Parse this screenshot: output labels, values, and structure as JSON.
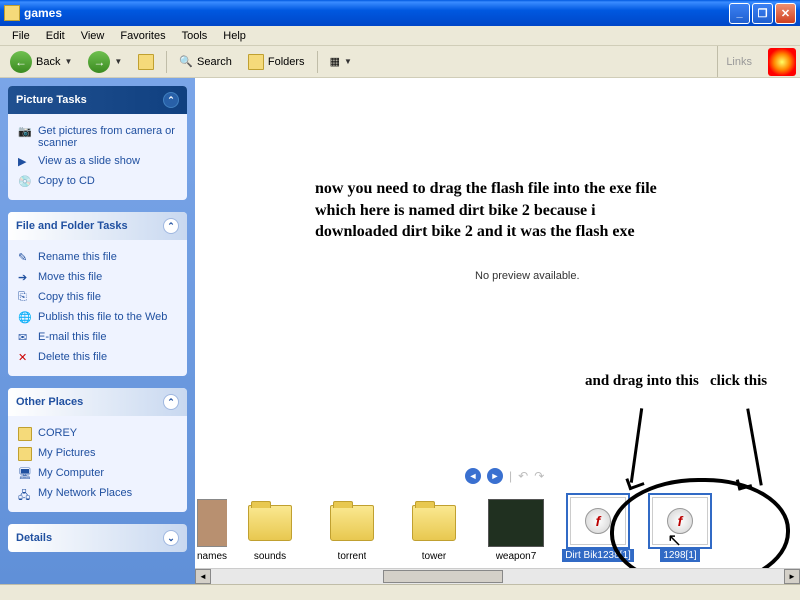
{
  "window": {
    "title": "games"
  },
  "menu": {
    "file": "File",
    "edit": "Edit",
    "view": "View",
    "favorites": "Favorites",
    "tools": "Tools",
    "help": "Help"
  },
  "toolbar": {
    "back": "Back",
    "search": "Search",
    "folders": "Folders",
    "links": "Links"
  },
  "sidebar": {
    "picture_tasks": {
      "title": "Picture Tasks",
      "items": [
        {
          "label": "Get pictures from camera or scanner"
        },
        {
          "label": "View as a slide show"
        },
        {
          "label": "Copy to CD"
        }
      ]
    },
    "file_tasks": {
      "title": "File and Folder Tasks",
      "items": [
        {
          "label": "Rename this file"
        },
        {
          "label": "Move this file"
        },
        {
          "label": "Copy this file"
        },
        {
          "label": "Publish this file to the Web"
        },
        {
          "label": "E-mail this file"
        },
        {
          "label": "Delete this file"
        }
      ]
    },
    "other_places": {
      "title": "Other Places",
      "items": [
        {
          "label": "COREY"
        },
        {
          "label": "My Pictures"
        },
        {
          "label": "My Computer"
        },
        {
          "label": "My Network Places"
        }
      ]
    },
    "details": {
      "title": "Details"
    }
  },
  "content": {
    "instruction": "now you need to drag the flash file into the exe file which here is named dirt bike 2 because i downloaded dirt bike 2 and it was the flash exe",
    "no_preview": "No preview available.",
    "ann_drag": "and drag into this",
    "ann_click": "click this"
  },
  "filmstrip": [
    {
      "label": "names",
      "type": "image"
    },
    {
      "label": "sounds",
      "type": "folder"
    },
    {
      "label": "torrent",
      "type": "folder"
    },
    {
      "label": "tower",
      "type": "folder"
    },
    {
      "label": "weapon7",
      "type": "dark"
    },
    {
      "label": "Dirt Bik1238[1]",
      "type": "flash",
      "selected": true
    },
    {
      "label": "1298[1]",
      "type": "flash",
      "selected": true
    }
  ]
}
